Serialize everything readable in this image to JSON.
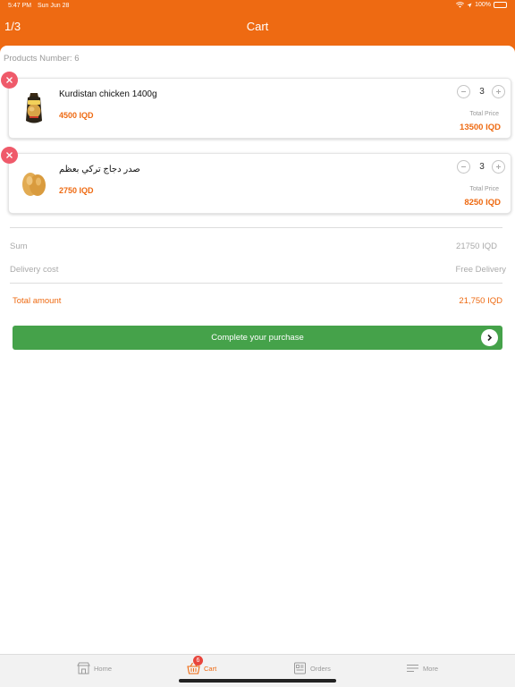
{
  "status_bar": {
    "time": "5:47 PM",
    "date": "Sun Jun 28",
    "battery": "100%"
  },
  "header": {
    "page_counter": "1/3",
    "title": "Cart"
  },
  "cart": {
    "products_count": "Products Number: 6",
    "items": [
      {
        "name": "Kurdistan chicken  1400g",
        "price": "4500 IQD",
        "quantity": "3",
        "total_label": "Total Price",
        "total": "13500 IQD",
        "image_icon": "chicken-package-icon"
      },
      {
        "name": "صدر دجاج  تركي بعظم",
        "price": "2750 IQD",
        "quantity": "3",
        "total_label": "Total Price",
        "total": "8250 IQD",
        "image_icon": "chicken-breast-icon"
      }
    ]
  },
  "summary": {
    "sum_label": "Sum",
    "sum_value": "21750 IQD",
    "delivery_label": "Delivery cost",
    "delivery_value": "Free Delivery",
    "total_label": "Total amount",
    "total_value": "21,750 IQD"
  },
  "checkout": {
    "label": "Complete your purchase"
  },
  "tabbar": {
    "tabs": [
      {
        "label": "Home",
        "icon": "store-icon"
      },
      {
        "label": "Cart",
        "icon": "basket-icon",
        "badge": "6",
        "active": true
      },
      {
        "label": "Orders",
        "icon": "orders-icon"
      },
      {
        "label": "More",
        "icon": "menu-icon"
      }
    ]
  },
  "colors": {
    "brand": "#ee6a12",
    "checkout_green": "#45a24a",
    "remove_red": "#ef5a6a",
    "badge_red": "#e8453c"
  }
}
